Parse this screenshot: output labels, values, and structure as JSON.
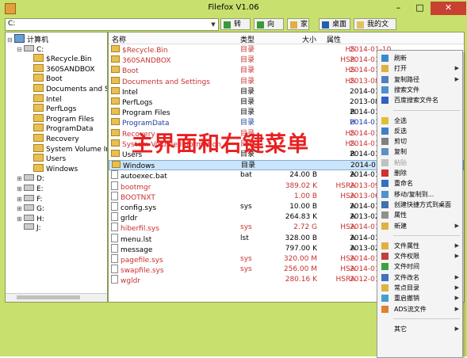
{
  "window": {
    "title": "Filefox V1.06",
    "minimize": "–",
    "maximize": "□",
    "close": "✕"
  },
  "toolbar": {
    "address": "C:",
    "go_label": "转到",
    "up_label": "向上",
    "home_label": "家",
    "desktop_label": "桌面",
    "docs_label": "我的文档"
  },
  "tree": [
    {
      "label": "计算机",
      "level": 0,
      "kind": "pc",
      "expander": "⊟"
    },
    {
      "label": "C:",
      "level": 1,
      "kind": "drive",
      "expander": "⊟"
    },
    {
      "label": "$Recycle.Bin",
      "level": 2,
      "kind": "folder",
      "expander": ""
    },
    {
      "label": "360SANDBOX",
      "level": 2,
      "kind": "folder",
      "expander": ""
    },
    {
      "label": "Boot",
      "level": 2,
      "kind": "folder",
      "expander": ""
    },
    {
      "label": "Documents and Se",
      "level": 2,
      "kind": "folder",
      "expander": ""
    },
    {
      "label": "Intel",
      "level": 2,
      "kind": "folder",
      "expander": ""
    },
    {
      "label": "PerfLogs",
      "level": 2,
      "kind": "folder",
      "expander": ""
    },
    {
      "label": "Program Files",
      "level": 2,
      "kind": "folder",
      "expander": ""
    },
    {
      "label": "ProgramData",
      "level": 2,
      "kind": "folder",
      "expander": ""
    },
    {
      "label": "Recovery",
      "level": 2,
      "kind": "folder",
      "expander": ""
    },
    {
      "label": "System Volume Inf",
      "level": 2,
      "kind": "folder",
      "expander": ""
    },
    {
      "label": "Users",
      "level": 2,
      "kind": "folder",
      "expander": ""
    },
    {
      "label": "Windows",
      "level": 2,
      "kind": "folder",
      "expander": ""
    },
    {
      "label": "D:",
      "level": 1,
      "kind": "drive",
      "expander": "⊞"
    },
    {
      "label": "E:",
      "level": 1,
      "kind": "drive",
      "expander": "⊞"
    },
    {
      "label": "F:",
      "level": 1,
      "kind": "drive",
      "expander": "⊞"
    },
    {
      "label": "G:",
      "level": 1,
      "kind": "drive",
      "expander": "⊞"
    },
    {
      "label": "H:",
      "level": 1,
      "kind": "drive",
      "expander": "⊞"
    },
    {
      "label": "J:",
      "level": 1,
      "kind": "drive",
      "expander": ""
    }
  ],
  "list": {
    "headers": {
      "name": "名称",
      "type": "类型",
      "size": "大小",
      "attr": "属性"
    },
    "rows": [
      {
        "name": "$Recycle.Bin",
        "type": "目录",
        "size": "",
        "attr": "HS",
        "date": "2014-01-10",
        "color": "red",
        "kind": "folder"
      },
      {
        "name": "360SANDBOX",
        "type": "目录",
        "size": "",
        "attr": "HSR",
        "date": "2014-01-",
        "color": "red",
        "kind": "folder"
      },
      {
        "name": "Boot",
        "type": "目录",
        "size": "",
        "attr": "HS",
        "date": "2014-01-",
        "color": "red",
        "kind": "folder"
      },
      {
        "name": "Documents and Settings",
        "type": "目录",
        "size": "",
        "attr": "HS",
        "date": "2013-08",
        "color": "red",
        "kind": "folder"
      },
      {
        "name": "Intel",
        "type": "目录",
        "size": "",
        "attr": "",
        "date": "2014-01-",
        "color": "black",
        "kind": "folder"
      },
      {
        "name": "PerfLogs",
        "type": "目录",
        "size": "",
        "attr": "",
        "date": "2013-08",
        "color": "black",
        "kind": "folder"
      },
      {
        "name": "Program Files",
        "type": "目录",
        "size": "",
        "attr": "R",
        "date": "2014-01",
        "color": "black",
        "kind": "folder"
      },
      {
        "name": "ProgramData",
        "type": "目录",
        "size": "",
        "attr": "H",
        "date": "2014-01",
        "color": "blue",
        "kind": "folder"
      },
      {
        "name": "Recovery",
        "type": "目录",
        "size": "",
        "attr": "HS",
        "date": "2014-01",
        "color": "red",
        "kind": "folder"
      },
      {
        "name": "System Volume Information",
        "type": "目录",
        "size": "",
        "attr": "HS",
        "date": "2014-01",
        "color": "red",
        "kind": "folder"
      },
      {
        "name": "Users",
        "type": "目录",
        "size": "",
        "attr": "R",
        "date": "2014-01",
        "color": "black",
        "kind": "folder"
      },
      {
        "name": "Windows",
        "type": "目录",
        "size": "",
        "attr": "",
        "date": "2014-01",
        "color": "black",
        "kind": "folder",
        "selected": true
      },
      {
        "name": "autoexec.bat",
        "type": "bat",
        "size": "24.00 B",
        "attr": "A",
        "date": "2014-01",
        "color": "black",
        "kind": "file"
      },
      {
        "name": "bootmgr",
        "type": "",
        "size": "389.02 K",
        "attr": "HSRA",
        "date": "2013-09",
        "color": "red",
        "kind": "file"
      },
      {
        "name": "BOOTNXT",
        "type": "",
        "size": "1.00 B",
        "attr": "HSA",
        "date": "2013-06",
        "color": "red",
        "kind": "file"
      },
      {
        "name": "config.sys",
        "type": "sys",
        "size": "10.00 B",
        "attr": "A",
        "date": "2014-01",
        "color": "black",
        "kind": "file"
      },
      {
        "name": "grldr",
        "type": "",
        "size": "264.83 K",
        "attr": "A",
        "date": "2013-02",
        "color": "black",
        "kind": "file"
      },
      {
        "name": "hiberfil.sys",
        "type": "sys",
        "size": "2.72 G",
        "attr": "HSA",
        "date": "2014-01",
        "color": "red",
        "kind": "file"
      },
      {
        "name": "menu.lst",
        "type": "lst",
        "size": "328.00 B",
        "attr": "A",
        "date": "2014-01",
        "color": "black",
        "kind": "file"
      },
      {
        "name": "message",
        "type": "",
        "size": "797.00 K",
        "attr": "A",
        "date": "2013-02",
        "color": "black",
        "kind": "file"
      },
      {
        "name": "pagefile.sys",
        "type": "sys",
        "size": "320.00 M",
        "attr": "HSA",
        "date": "2014-01",
        "color": "red",
        "kind": "file"
      },
      {
        "name": "swapfile.sys",
        "type": "sys",
        "size": "256.00 M",
        "attr": "HSA",
        "date": "2014-01",
        "color": "red",
        "kind": "file"
      },
      {
        "name": "wgldr",
        "type": "",
        "size": "280.16 K",
        "attr": "HSRA",
        "date": "2012-01",
        "color": "red",
        "kind": "file"
      }
    ]
  },
  "overlay_caption": "主界面和右键菜单",
  "context_menu": [
    {
      "label": "刷新",
      "icon": "refresh-icon",
      "icolor": "#3a8ad0",
      "arrow": false
    },
    {
      "label": "打开",
      "icon": "open-icon",
      "icolor": "#e0b040",
      "arrow": true
    },
    {
      "label": "复制路径",
      "icon": "copy-path-icon",
      "icolor": "#5080c0",
      "arrow": true
    },
    {
      "label": "搜索文件",
      "icon": "search-file-icon",
      "icolor": "#4a90d0",
      "arrow": false
    },
    {
      "label": "百度搜索文件名",
      "icon": "baidu-search-icon",
      "icolor": "#3060c0",
      "arrow": false
    },
    {
      "sep": true
    },
    {
      "label": "全选",
      "icon": "select-all-icon",
      "icolor": "#e0c030",
      "arrow": false
    },
    {
      "label": "反选",
      "icon": "invert-select-icon",
      "icolor": "#4080c0",
      "arrow": false
    },
    {
      "label": "剪切",
      "icon": "cut-icon",
      "icolor": "#808080",
      "arrow": false
    },
    {
      "label": "复制",
      "icon": "copy-icon",
      "icolor": "#6090c0",
      "arrow": false
    },
    {
      "label": "粘贴",
      "icon": "paste-icon",
      "icolor": "#c0c0c0",
      "arrow": false,
      "disabled": true
    },
    {
      "label": "删除",
      "icon": "delete-icon",
      "icolor": "#d03030",
      "arrow": false
    },
    {
      "label": "重命名",
      "icon": "rename-icon",
      "icolor": "#3070c0",
      "arrow": false
    },
    {
      "label": "移动/复制到...",
      "icon": "move-copy-icon",
      "icolor": "#5090d0",
      "arrow": false
    },
    {
      "label": "创建快捷方式到桌面",
      "icon": "shortcut-icon",
      "icolor": "#4070b0",
      "arrow": false
    },
    {
      "label": "属性",
      "icon": "properties-icon",
      "icolor": "#909090",
      "arrow": false
    },
    {
      "label": "新建",
      "icon": "new-icon",
      "icolor": "#e0b040",
      "arrow": true
    },
    {
      "sep": true
    },
    {
      "label": "文件属性",
      "icon": "file-attr-icon",
      "icolor": "#e0b040",
      "arrow": true
    },
    {
      "label": "文件权限",
      "icon": "file-permission-icon",
      "icolor": "#c04040",
      "arrow": true
    },
    {
      "label": "文件时间",
      "icon": "file-time-icon",
      "icolor": "#40a040",
      "arrow": false
    },
    {
      "label": "文件改名",
      "icon": "file-rename-icon",
      "icolor": "#4070c0",
      "arrow": true
    },
    {
      "label": "常点目录",
      "icon": "frequent-dir-icon",
      "icolor": "#e0b040",
      "arrow": true
    },
    {
      "label": "重启撤销",
      "icon": "restart-undo-icon",
      "icolor": "#40a0d0",
      "arrow": true
    },
    {
      "label": "ADS流文件",
      "icon": "ads-stream-icon",
      "icolor": "#e08030",
      "arrow": true
    },
    {
      "sep": true
    },
    {
      "label": "其它",
      "icon": "",
      "icolor": "",
      "arrow": true
    }
  ]
}
